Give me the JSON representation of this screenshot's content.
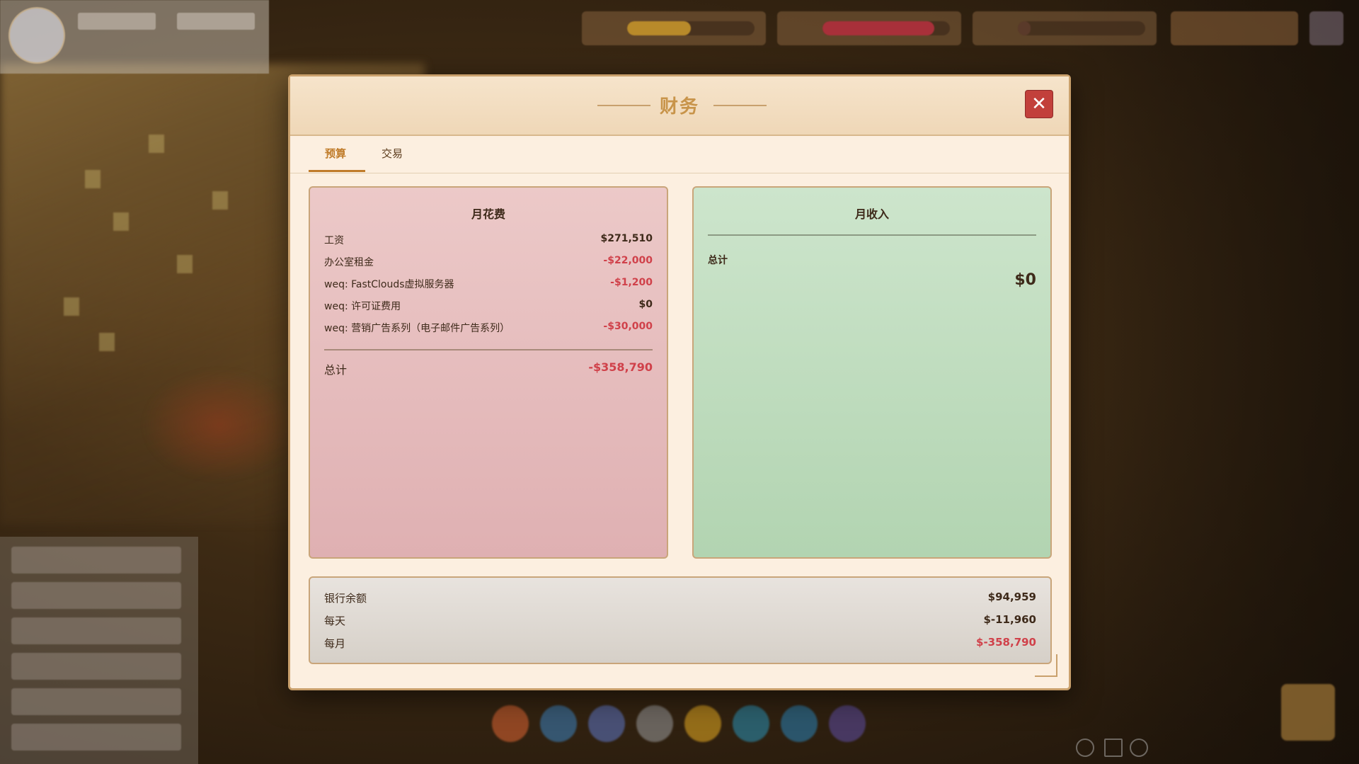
{
  "modal": {
    "title": "财务",
    "close_glyph": "✕",
    "tabs": [
      {
        "label": "预算",
        "active": true
      },
      {
        "label": "交易",
        "active": false
      }
    ]
  },
  "expenses": {
    "title": "月花费",
    "items": [
      {
        "label": "工资",
        "amount": "$271,510",
        "negative": false
      },
      {
        "label": "办公室租金",
        "amount": "-$22,000",
        "negative": true
      },
      {
        "label": "weq: FastClouds虚拟服务器",
        "amount": "-$1,200",
        "negative": true
      },
      {
        "label": "weq: 许可证费用",
        "amount": "$0",
        "negative": false
      },
      {
        "label": "weq: 营销广告系列（电子邮件广告系列）",
        "amount": "-$30,000",
        "negative": true
      }
    ],
    "total_label": "总计",
    "total_amount": "-$358,790"
  },
  "income": {
    "title": "月收入",
    "total_label": "总计",
    "total_amount": "$0"
  },
  "bank": {
    "rows": [
      {
        "label": "银行余额",
        "amount": "$94,959",
        "negative": false
      },
      {
        "label": "每天",
        "amount": "$-11,960",
        "negative": false
      },
      {
        "label": "每月",
        "amount": "$-358,790",
        "negative": true
      }
    ]
  },
  "colors": {
    "accent": "#c07c2a",
    "negative": "#d0414a",
    "close_button": "#c2403b",
    "expense_panel": "#e6bcbd",
    "income_panel": "#c0dcbf"
  },
  "background_hud": {
    "icons": [
      "player-avatar-icon",
      "play-speed-icon",
      "settings-icon"
    ]
  }
}
